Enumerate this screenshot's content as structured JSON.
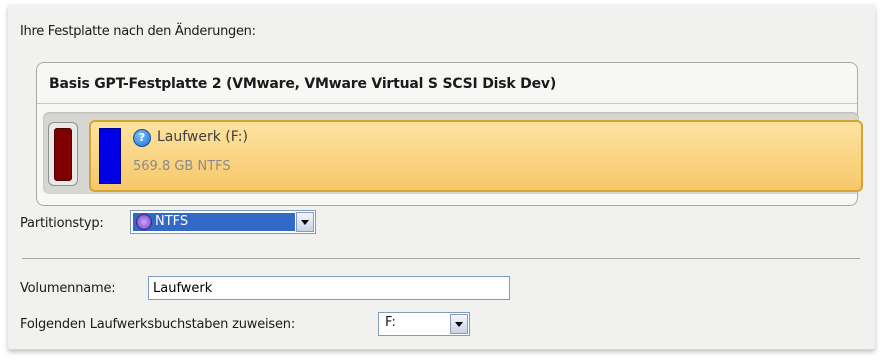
{
  "section_heading": "Ihre Festplatte nach den Änderungen:",
  "disk": {
    "title": "Basis GPT-Festplatte 2 (VMware, VMware Virtual S SCSI Disk Dev)",
    "partition": {
      "name": "Laufwerk (F:)",
      "info": "569.8 GB NTFS",
      "help_icon": "?"
    },
    "colors": {
      "small_partition": "#800000",
      "main_partition_bar": "#0000e6",
      "main_partition_bg": "#fbd98a",
      "main_partition_border": "#d9a333"
    }
  },
  "partition_type": {
    "label": "Partitionstyp:",
    "selected": "NTFS",
    "icon": "ntfs-icon"
  },
  "volume_name": {
    "label": "Volumenname:",
    "value": "Laufwerk"
  },
  "drive_letter": {
    "label": "Folgenden Laufwerksbuchstaben zuweisen:",
    "selected": "F:"
  }
}
